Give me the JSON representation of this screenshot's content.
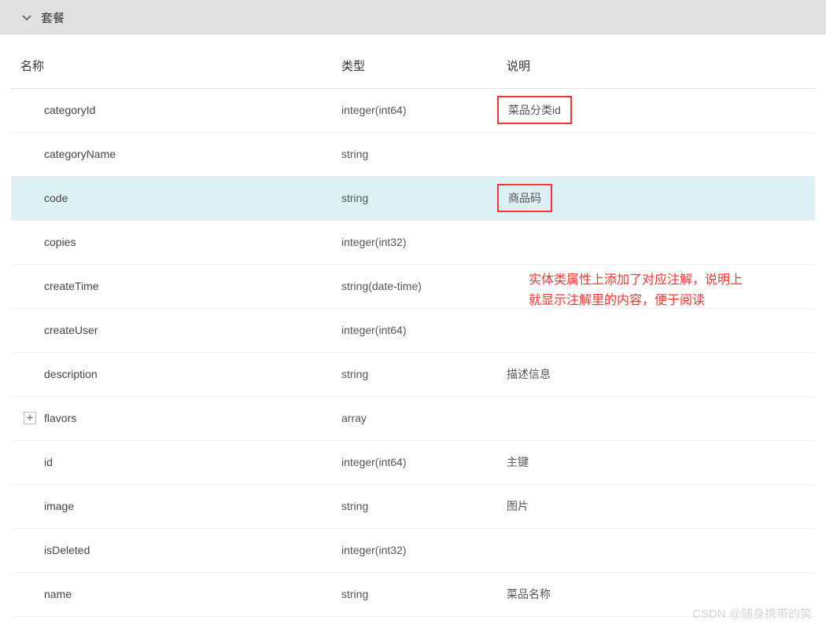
{
  "header": {
    "title": "套餐"
  },
  "columns": {
    "name": "名称",
    "type": "类型",
    "desc": "说明"
  },
  "rows": [
    {
      "name": "categoryId",
      "type": "integer(int64)",
      "desc": "菜品分类id",
      "highlight": false,
      "descBoxed": true,
      "expand": false
    },
    {
      "name": "categoryName",
      "type": "string",
      "desc": "",
      "highlight": false,
      "descBoxed": false,
      "expand": false
    },
    {
      "name": "code",
      "type": "string",
      "desc": "商品码",
      "highlight": true,
      "descBoxed": true,
      "expand": false
    },
    {
      "name": "copies",
      "type": "integer(int32)",
      "desc": "",
      "highlight": false,
      "descBoxed": false,
      "expand": false
    },
    {
      "name": "createTime",
      "type": "string(date-time)",
      "desc": "",
      "highlight": false,
      "descBoxed": false,
      "expand": false
    },
    {
      "name": "createUser",
      "type": "integer(int64)",
      "desc": "",
      "highlight": false,
      "descBoxed": false,
      "expand": false
    },
    {
      "name": "description",
      "type": "string",
      "desc": "描述信息",
      "highlight": false,
      "descBoxed": false,
      "expand": false
    },
    {
      "name": "flavors",
      "type": "array",
      "desc": "",
      "highlight": false,
      "descBoxed": false,
      "expand": true
    },
    {
      "name": "id",
      "type": "integer(int64)",
      "desc": "主键",
      "highlight": false,
      "descBoxed": false,
      "expand": false
    },
    {
      "name": "image",
      "type": "string",
      "desc": "图片",
      "highlight": false,
      "descBoxed": false,
      "expand": false
    },
    {
      "name": "isDeleted",
      "type": "integer(int32)",
      "desc": "",
      "highlight": false,
      "descBoxed": false,
      "expand": false
    },
    {
      "name": "name",
      "type": "string",
      "desc": "菜品名称",
      "highlight": false,
      "descBoxed": false,
      "expand": false
    }
  ],
  "annotation": {
    "line1": "实体类属性上添加了对应注解，说明上",
    "line2": "就显示注解里的内容，便于阅读"
  },
  "watermark": "CSDN @随身携带的笑"
}
